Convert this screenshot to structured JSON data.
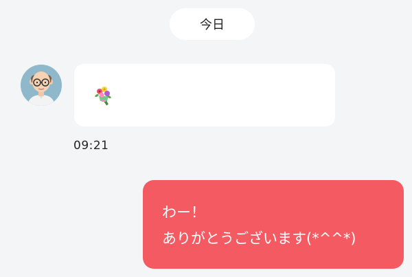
{
  "date_divider": {
    "label": "今日"
  },
  "incoming_message": {
    "content_icon": "bouquet-icon",
    "timestamp": "09:21"
  },
  "outgoing_message": {
    "lines": [
      "わー！",
      "ありがとうございます(*^^*)"
    ],
    "bubble_color": "#f45a62"
  },
  "colors": {
    "background": "#f4f5f7",
    "incoming_bubble": "#ffffff",
    "avatar_background": "#8fb9cb"
  }
}
